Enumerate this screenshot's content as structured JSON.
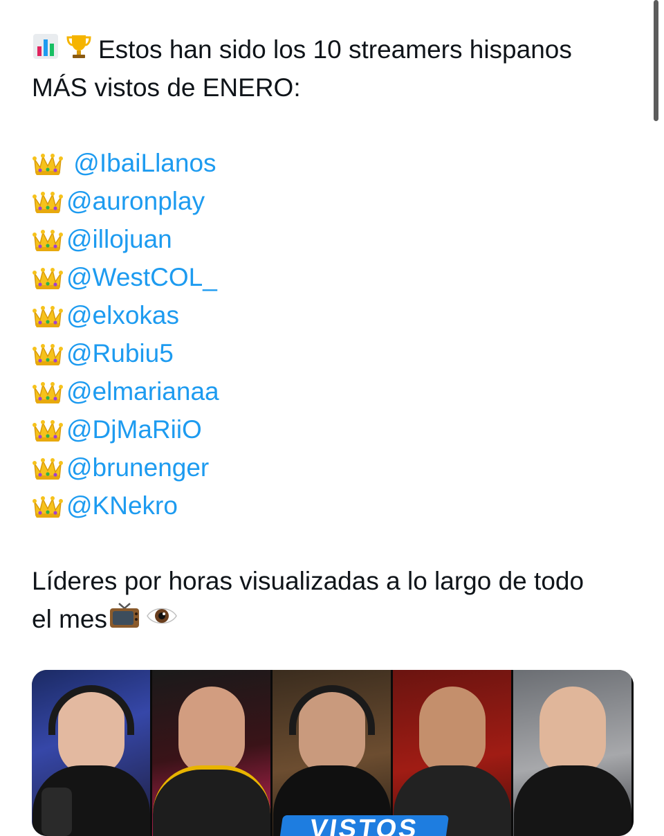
{
  "tweet": {
    "intro_line1": "Estos han sido los 10 streamers hispanos",
    "intro_line2": "MÁS vistos de ENERO:",
    "intro_icons": [
      "bar-chart-icon",
      "trophy-icon"
    ],
    "mentions": [
      "@IbaiLlanos",
      "@auronplay",
      "@illojuan",
      "@WestCOL_",
      "@elxokas",
      "@Rubiu5",
      "@elmarianaa",
      "@DjMaRiiO",
      "@brunenger",
      "@KNekro"
    ],
    "mention_icon": "crown-icon",
    "outro_line1": "Líderes por horas visualizadas a lo largo de todo",
    "outro_line2": "el mes",
    "outro_icons": [
      "television-icon",
      "eye-icon"
    ]
  },
  "media": {
    "banner_text": "VISTOS",
    "panels": 5
  },
  "colors": {
    "text": "#0f1419",
    "mention": "#1d9bf0",
    "banner": "#1e7de0"
  }
}
